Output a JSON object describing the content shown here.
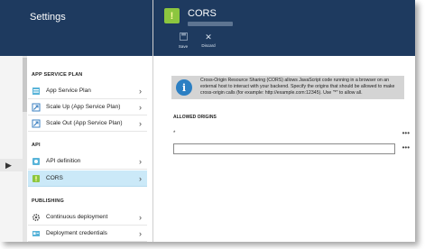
{
  "settings": {
    "title": "Settings",
    "sections": [
      {
        "label": "APP SERVICE PLAN",
        "items": [
          {
            "label": "App Service Plan",
            "icon": "app-service-plan-icon"
          },
          {
            "label": "Scale Up (App Service Plan)",
            "icon": "scale-up-icon"
          },
          {
            "label": "Scale Out (App Service Plan)",
            "icon": "scale-out-icon"
          }
        ]
      },
      {
        "label": "API",
        "items": [
          {
            "label": "API definition",
            "icon": "api-definition-icon"
          },
          {
            "label": "CORS",
            "icon": "cors-icon",
            "selected": true
          }
        ]
      },
      {
        "label": "PUBLISHING",
        "items": [
          {
            "label": "Continuous deployment",
            "icon": "gear-icon"
          },
          {
            "label": "Deployment credentials",
            "icon": "credentials-icon"
          }
        ]
      }
    ]
  },
  "cors": {
    "title": "CORS",
    "commands": {
      "save_label": "Save",
      "discard_label": "Discard"
    },
    "info_text": "Cross-Origin Resource Sharing (CORS) allows JavaScript code running in a browser on an external host to interact with your backend. Specify the origins that should be allowed to make cross-origin calls (for example: http://example.com:12345). Use \"*\" to allow all.",
    "allowed_origins_label": "ALLOWED ORIGINS",
    "origins": [
      "*"
    ],
    "new_origin_value": "",
    "more_label": "•••"
  },
  "colors": {
    "header": "#1e3a5f",
    "selected": "#cbe9f8",
    "info_bg": "#d4d4d4",
    "info_icon": "#2b7fc3",
    "cors_icon": "#8cc63f"
  }
}
